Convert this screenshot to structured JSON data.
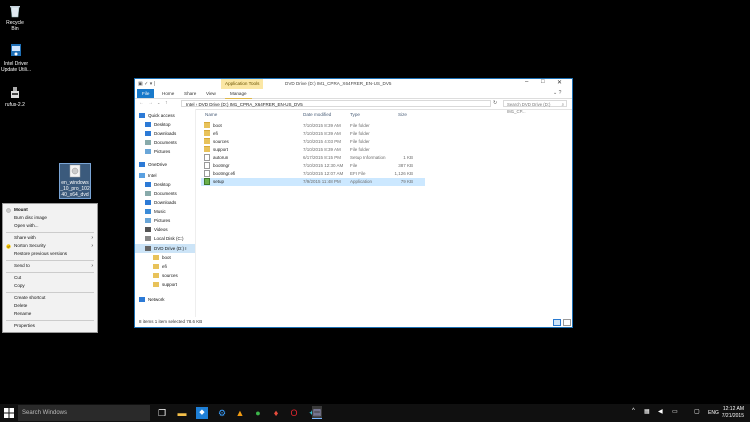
{
  "desktop": {
    "icons": [
      {
        "label": "Recycle Bin",
        "icon": "recycle-bin-icon"
      },
      {
        "label": "Intel Driver Update Utili...",
        "icon": "intel-driver-icon"
      },
      {
        "label": "rufus-2.2",
        "icon": "usb-drive-icon"
      },
      {
        "label": "en_windows_10_pro_10240_x64_dvd",
        "icon": "iso-file-icon"
      }
    ]
  },
  "context_menu": {
    "items": [
      {
        "label": "Mount",
        "bold": true
      },
      {
        "label": "Burn disc image"
      },
      {
        "label": "Open with..."
      },
      {
        "label": "Share with",
        "submenu": true
      },
      {
        "label": "Norton Security",
        "submenu": true
      },
      {
        "label": "Restore previous versions"
      },
      {
        "label": "Send to",
        "submenu": true
      },
      {
        "label": "Cut"
      },
      {
        "label": "Copy"
      },
      {
        "label": "Create shortcut"
      },
      {
        "label": "Delete"
      },
      {
        "label": "Rename"
      },
      {
        "label": "Properties"
      }
    ]
  },
  "explorer": {
    "title": "DVD Drive (D:) IM1_CPRA_X64FRER_EN-US_DV5",
    "tool_tab": "Application Tools",
    "ribbon_tabs": [
      "File",
      "Home",
      "Share",
      "View",
      "Manage"
    ],
    "address": "Intel  ›  DVD Drive (D:) IM1_CPRA_X64FRER_EN-US_DV5",
    "search_placeholder": "Search DVD Drive (D:) IM1_CP...",
    "columns": {
      "name": "Name",
      "date": "Date modified",
      "type": "Type",
      "size": "Size"
    },
    "nav": [
      {
        "label": "Quick access",
        "icon": "star-icon"
      },
      {
        "label": "Desktop",
        "icon": "desktop-icon"
      },
      {
        "label": "Downloads",
        "icon": "download-icon"
      },
      {
        "label": "Documents",
        "icon": "document-icon"
      },
      {
        "label": "Pictures",
        "icon": "pictures-icon"
      },
      {
        "label": "OneDrive",
        "icon": "cloud-icon"
      },
      {
        "label": "Intel",
        "icon": "computer-icon"
      },
      {
        "label": "Desktop",
        "icon": "desktop-icon"
      },
      {
        "label": "Documents",
        "icon": "document-icon"
      },
      {
        "label": "Downloads",
        "icon": "download-icon"
      },
      {
        "label": "Music",
        "icon": "music-icon"
      },
      {
        "label": "Pictures",
        "icon": "pictures-icon"
      },
      {
        "label": "Videos",
        "icon": "video-icon"
      },
      {
        "label": "Local Disk (C:)",
        "icon": "drive-icon"
      },
      {
        "label": "DVD Drive (D:) I",
        "icon": "dvd-icon"
      },
      {
        "label": "boot",
        "icon": "folder-icon"
      },
      {
        "label": "efi",
        "icon": "folder-icon"
      },
      {
        "label": "sources",
        "icon": "folder-icon"
      },
      {
        "label": "support",
        "icon": "folder-icon"
      },
      {
        "label": "Network",
        "icon": "network-icon"
      }
    ],
    "files": [
      {
        "name": "boot",
        "date": "7/10/2015 8:39 AM",
        "type": "File folder",
        "size": "",
        "kind": "folder"
      },
      {
        "name": "efi",
        "date": "7/10/2015 8:39 AM",
        "type": "File folder",
        "size": "",
        "kind": "folder"
      },
      {
        "name": "sources",
        "date": "7/10/2015 4:03 PM",
        "type": "File folder",
        "size": "",
        "kind": "folder"
      },
      {
        "name": "support",
        "date": "7/10/2015 8:39 AM",
        "type": "File folder",
        "size": "",
        "kind": "folder"
      },
      {
        "name": "autorun",
        "date": "6/17/2015 8:15 PM",
        "type": "Setup Information",
        "size": "1 KB",
        "kind": "file"
      },
      {
        "name": "bootmgr",
        "date": "7/10/2015 12:30 AM",
        "type": "File",
        "size": "387 KB",
        "kind": "file"
      },
      {
        "name": "bootmgr.efi",
        "date": "7/10/2015 12:07 AM",
        "type": "EFI File",
        "size": "1,126 KB",
        "kind": "file"
      },
      {
        "name": "setup",
        "date": "7/9/2015 11:48 PM",
        "type": "Application",
        "size": "79 KB",
        "kind": "app"
      }
    ],
    "status": "8 items    1 item selected  78.6 KB"
  },
  "taskbar": {
    "search_placeholder": "Search Windows",
    "language": "ENG",
    "time": "12:12 AM",
    "date": "7/21/2015"
  },
  "colors": {
    "accent": "#1979ca",
    "selection": "#cce8ff",
    "desktop": "#000000"
  }
}
